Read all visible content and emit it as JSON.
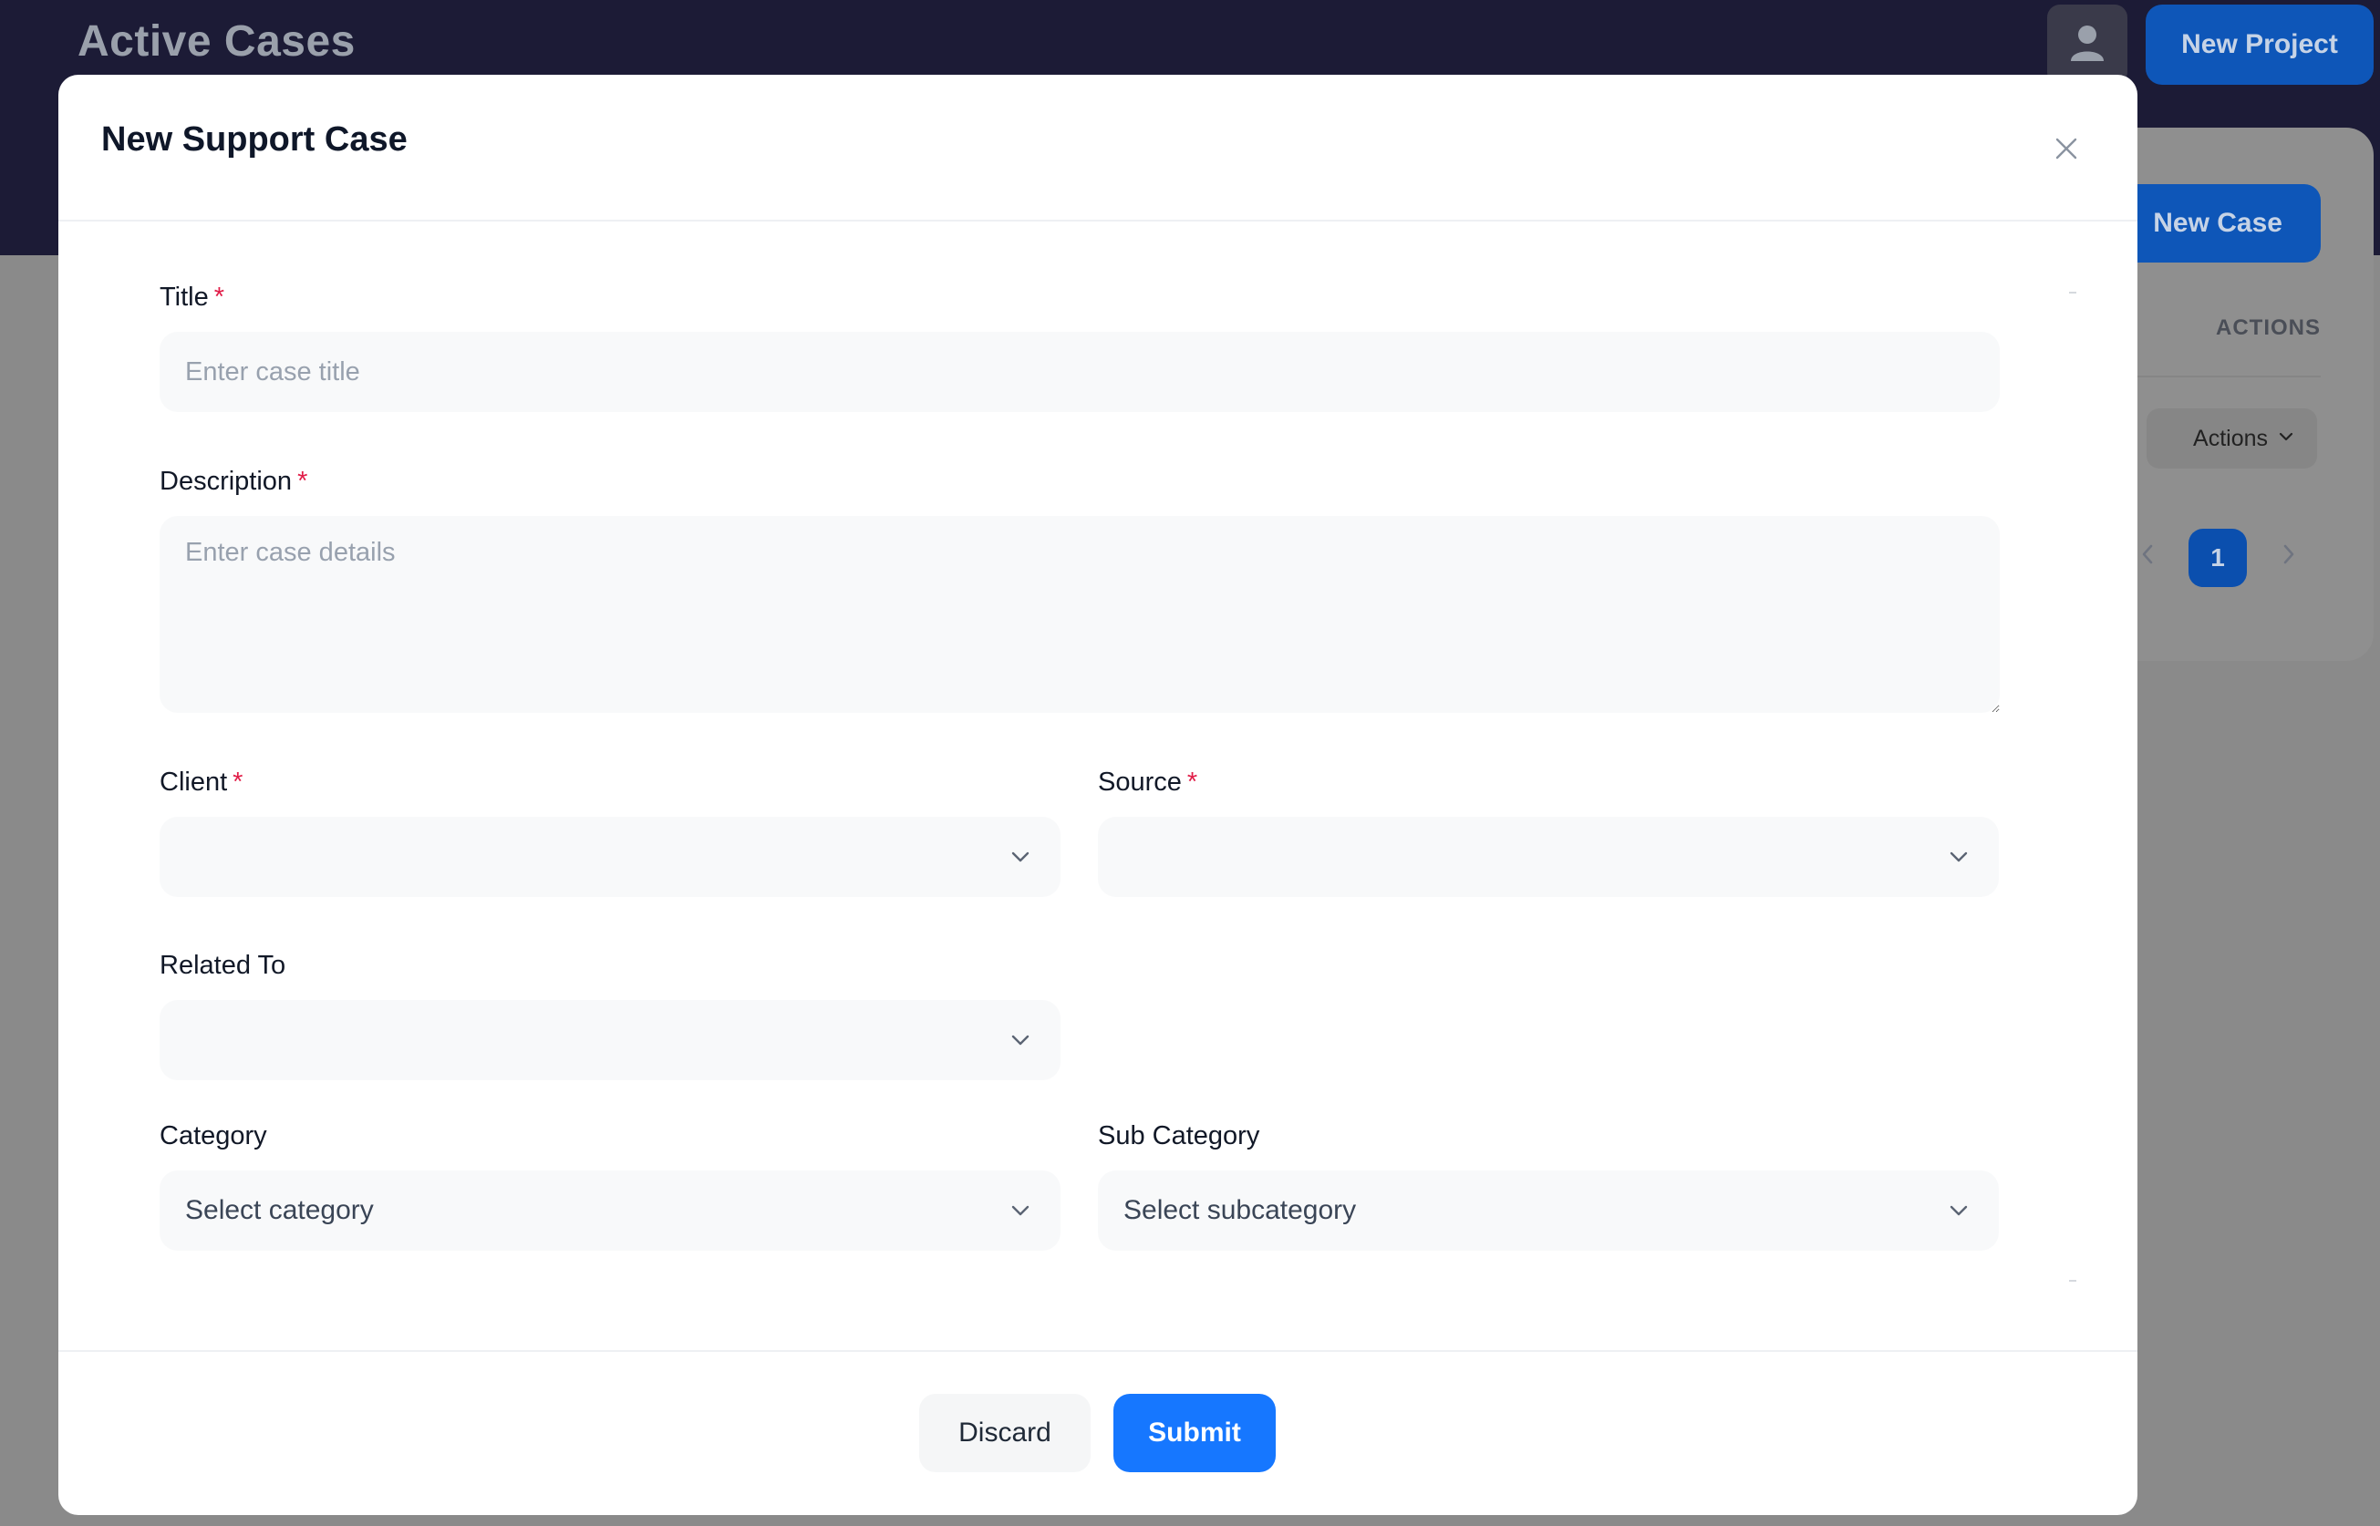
{
  "app": {
    "title": "Active Cases",
    "new_project_label": "New Project",
    "new_case_label": "New Case",
    "actions_column_header": "ACTIONS",
    "actions_dropdown_label": "Actions",
    "current_page": "1",
    "icons": {
      "avatar": "user-icon",
      "prev": "chevron-left-icon",
      "next": "chevron-right-icon",
      "dropdown": "chevron-down-icon"
    }
  },
  "modal": {
    "title": "New Support Case",
    "close_icon": "close-icon",
    "fields": {
      "title": {
        "label": "Title",
        "required_marker": "*",
        "placeholder": "Enter case title",
        "value": ""
      },
      "description": {
        "label": "Description",
        "required_marker": "*",
        "placeholder": "Enter case details",
        "value": ""
      },
      "client": {
        "label": "Client",
        "required_marker": "*",
        "selected": ""
      },
      "source": {
        "label": "Source",
        "required_marker": "*",
        "selected": ""
      },
      "related_to": {
        "label": "Related To",
        "selected": ""
      },
      "category": {
        "label": "Category",
        "selected": "Select category"
      },
      "sub_category": {
        "label": "Sub Category",
        "selected": "Select subcategory"
      }
    },
    "footer": {
      "discard_label": "Discard",
      "submit_label": "Submit"
    }
  },
  "colors": {
    "header_bg": "#1c1b36",
    "primary": "#1677ff",
    "required": "#e11d48",
    "overlay": "#8a8a8a"
  }
}
